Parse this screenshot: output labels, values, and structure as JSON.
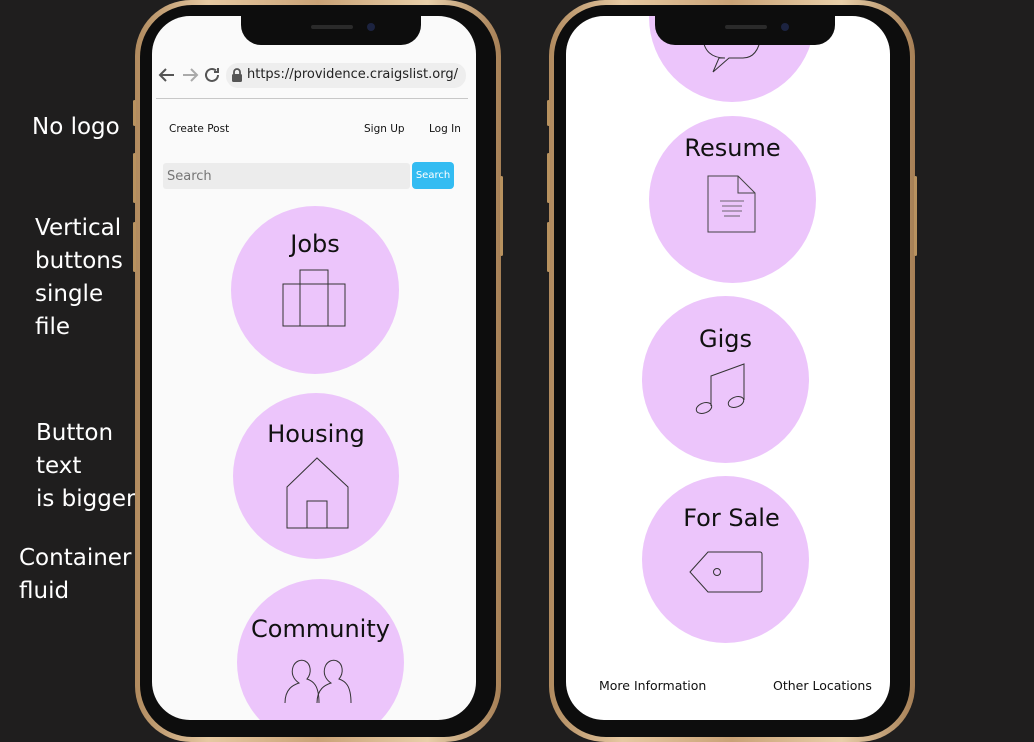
{
  "annotations": [
    {
      "id": "no-logo",
      "text": "No logo"
    },
    {
      "id": "vertical",
      "text": "Vertical\nbuttons\nsingle\nfile"
    },
    {
      "id": "bigger",
      "text": "Button\ntext\nis bigger"
    },
    {
      "id": "fluid",
      "text": "Container\nfluid"
    }
  ],
  "browser": {
    "url": "https://providence.craigslist.org/",
    "back_icon": "arrow-left-icon",
    "forward_icon": "arrow-right-icon",
    "reload_icon": "reload-icon",
    "lock_icon": "lock-icon"
  },
  "nav": {
    "create_post": "Create Post",
    "sign_up": "Sign Up",
    "log_in": "Log In"
  },
  "search": {
    "placeholder": "Search",
    "button": "Search"
  },
  "categories_left": [
    {
      "label": "Jobs",
      "icon": "briefcase-icon"
    },
    {
      "label": "Housing",
      "icon": "house-icon"
    },
    {
      "label": "Community",
      "icon": "people-icon"
    }
  ],
  "categories_right": [
    {
      "label": "",
      "icon": "speech-bubble-icon"
    },
    {
      "label": "Resume",
      "icon": "document-icon"
    },
    {
      "label": "Gigs",
      "icon": "music-note-icon"
    },
    {
      "label": "For Sale",
      "icon": "price-tag-icon"
    }
  ],
  "footer": {
    "more_info": "More Information",
    "other_locations": "Other Locations"
  },
  "colors": {
    "background": "#1f1e1e",
    "circle": "#ecc5fb",
    "search_button": "#33bcf2",
    "phone_frame": "#c9a276"
  }
}
